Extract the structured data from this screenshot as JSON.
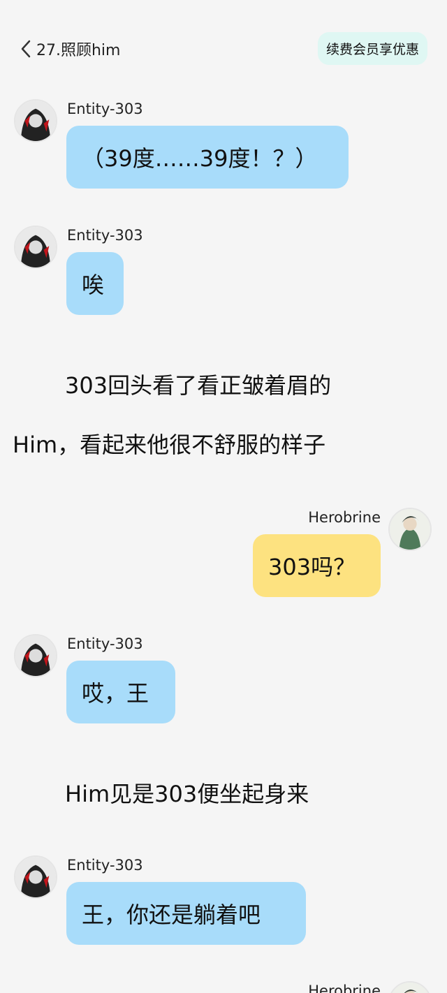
{
  "header": {
    "chapter_title": "27.照顾him",
    "vip_label": "续费会员享优惠"
  },
  "messages": [
    {
      "sender": "Entity-303",
      "text": "（39度……39度！？）"
    },
    {
      "sender": "Entity-303",
      "text": "唉"
    },
    {
      "sender": "Herobrine",
      "text": "303吗？"
    },
    {
      "sender": "Entity-303",
      "text": "哎，王"
    },
    {
      "sender": "Entity-303",
      "text": "王，你还是躺着吧"
    },
    {
      "sender": "Herobrine",
      "text": ""
    }
  ],
  "narrations": [
    {
      "line1": "303回头看了看正皱着眉的",
      "line2": "Him，看起来他很不舒服的样子"
    },
    {
      "line1": "Him见是303便坐起身来"
    }
  ],
  "colors": {
    "background": "#f5f5f5",
    "bubble_other": "#a8dcfa",
    "bubble_self": "#fde280",
    "vip_bg": "#dff7f3"
  }
}
